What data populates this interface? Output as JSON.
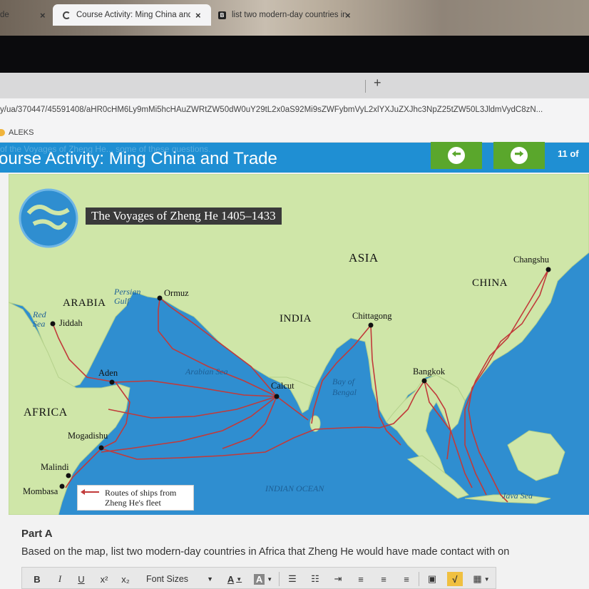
{
  "browser": {
    "tabs": [
      {
        "label": "de",
        "close": "×"
      },
      {
        "label": "Course Activity: Ming China and",
        "close": "×"
      },
      {
        "label": "list two modern-day countries in",
        "close": "×"
      }
    ],
    "new_tab": "+",
    "url": "y/ua/370447/45591408/aHR0cHM6Ly9mMi5hcHAuZWRtZW50dW0uY29tL2x0aS92Mi9sZWFybmVyL2xlYXJuZXJhc3NpZ25tZW50L3JldmVydC8zN...",
    "bookmark": "ALEKS"
  },
  "course": {
    "ghost_text": "of the Voyages of Zheng He... some of these questions.",
    "title": "ourse Activity: Ming China and Trade",
    "prev_icon": "arrow-left-icon",
    "next_icon": "arrow-right-icon",
    "pager": "11 of"
  },
  "map": {
    "title": "The Voyages of Zheng He 1405–1433",
    "regions": {
      "asia": "ASIA",
      "china": "CHINA",
      "arabia": "ARABIA",
      "india": "INDIA",
      "africa": "AFRICA"
    },
    "cities": {
      "changshu": "Changshu",
      "ormuz": "Ormuz",
      "jiddah": "Jiddah",
      "chittagong": "Chittagong",
      "aden": "Aden",
      "calcut": "Calcut",
      "bangkok": "Bangkok",
      "mogadishu": "Mogadishu",
      "malindi": "Malindi",
      "mombasa": "Mombasa"
    },
    "waters": {
      "persian_gulf": "Persian Gulf",
      "red_sea": "Red Sea",
      "arabian_sea": "Arabian Sea",
      "bay_of_bengal": "Bay of Bengal",
      "indian_ocean": "INDIAN OCEAN",
      "java_sea": "Java Sea"
    },
    "legend": "Routes of ships from Zheng He's fleet",
    "colors": {
      "ocean": "#2f8ed0",
      "land": "#cfe6a8",
      "route": "#c13a3a"
    }
  },
  "question": {
    "part": "Part A",
    "text": "Based on the map, list two modern-day countries in Africa that Zheng He would have made contact with on"
  },
  "editor_toolbar": {
    "bold": "B",
    "italic": "I",
    "underline": "U",
    "superscript": "x²",
    "subscript": "x₂",
    "font_sizes": "Font Sizes",
    "font_color": "A",
    "highlight": "A"
  }
}
